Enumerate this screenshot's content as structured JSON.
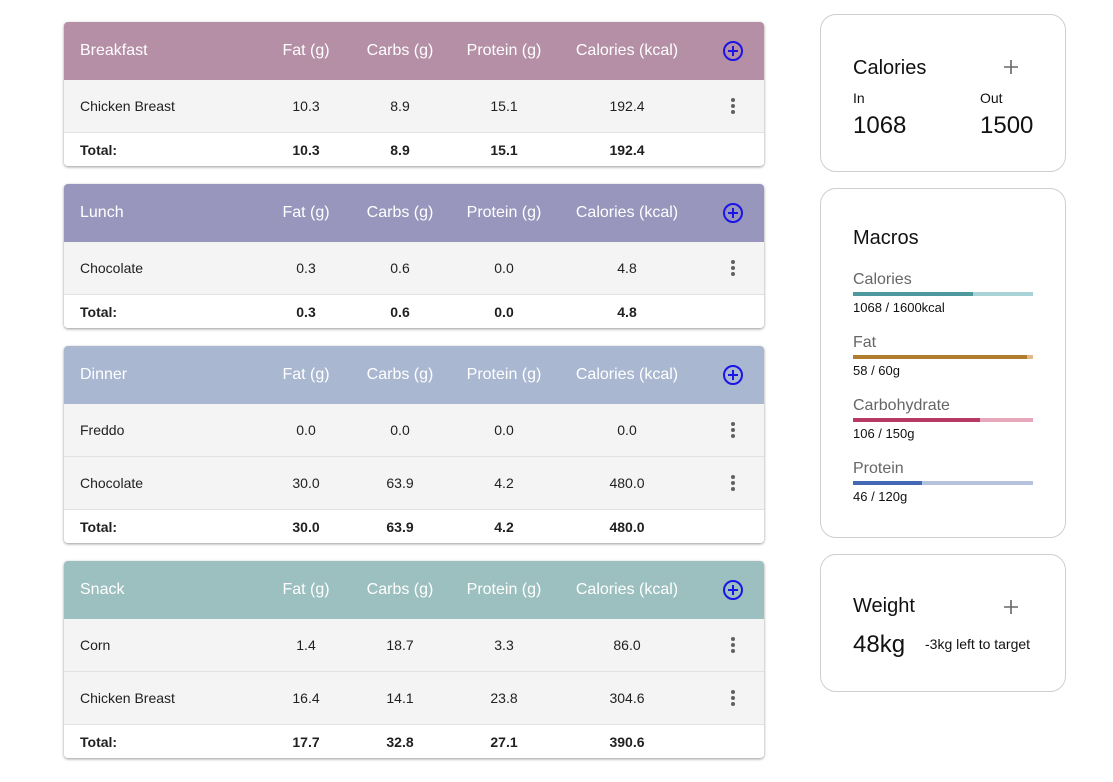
{
  "columns": {
    "fat": "Fat (g)",
    "carbs": "Carbs (g)",
    "protein": "Protein (g)",
    "calories": "Calories (kcal)"
  },
  "total_label": "Total:",
  "meals": [
    {
      "name": "Breakfast",
      "color": "#b58fa6",
      "foods": [
        {
          "name": "Chicken Breast",
          "fat": "10.3",
          "carbs": "8.9",
          "protein": "15.1",
          "calories": "192.4"
        }
      ],
      "total": {
        "fat": "10.3",
        "carbs": "8.9",
        "protein": "15.1",
        "calories": "192.4"
      }
    },
    {
      "name": "Lunch",
      "color": "#9896bc",
      "foods": [
        {
          "name": "Chocolate",
          "fat": "0.3",
          "carbs": "0.6",
          "protein": "0.0",
          "calories": "4.8"
        }
      ],
      "total": {
        "fat": "0.3",
        "carbs": "0.6",
        "protein": "0.0",
        "calories": "4.8"
      }
    },
    {
      "name": "Dinner",
      "color": "#a9b7d1",
      "foods": [
        {
          "name": "Freddo",
          "fat": "0.0",
          "carbs": "0.0",
          "protein": "0.0",
          "calories": "0.0"
        },
        {
          "name": "Chocolate",
          "fat": "30.0",
          "carbs": "63.9",
          "protein": "4.2",
          "calories": "480.0"
        }
      ],
      "total": {
        "fat": "30.0",
        "carbs": "63.9",
        "protein": "4.2",
        "calories": "480.0"
      }
    },
    {
      "name": "Snack",
      "color": "#9cbfbf",
      "foods": [
        {
          "name": "Corn",
          "fat": "1.4",
          "carbs": "18.7",
          "protein": "3.3",
          "calories": "86.0"
        },
        {
          "name": "Chicken Breast",
          "fat": "16.4",
          "carbs": "14.1",
          "protein": "23.8",
          "calories": "304.6"
        }
      ],
      "total": {
        "fat": "17.7",
        "carbs": "32.8",
        "protein": "27.1",
        "calories": "390.6"
      }
    }
  ],
  "icons": {
    "add_meal": "add-circle-icon",
    "food_menu": "more-vert-icon",
    "card_add": "plus-icon"
  },
  "accent_color": "#1a14e6",
  "calories_card": {
    "title": "Calories",
    "in_label": "In",
    "in_value": "1068",
    "out_label": "Out",
    "out_value": "1500"
  },
  "macros_card": {
    "title": "Macros",
    "items": [
      {
        "name": "Calories",
        "label": "1068 / 1600kcal",
        "progress": 0.667,
        "color": "#4e999d",
        "track_color": "#a9d2d6"
      },
      {
        "name": "Fat",
        "label": "58 / 60g",
        "progress": 0.967,
        "color": "#b07d2f",
        "track_color": "#e3b98a"
      },
      {
        "name": "Carbohydrate",
        "label": "106 / 150g",
        "progress": 0.707,
        "color": "#b83a64",
        "track_color": "#e8a8bb"
      },
      {
        "name": "Protein",
        "label": "46 / 120g",
        "progress": 0.383,
        "color": "#4568b5",
        "track_color": "#b4c2de"
      }
    ]
  },
  "weight_card": {
    "title": "Weight",
    "value": "48kg",
    "note": "-3kg left to target"
  }
}
